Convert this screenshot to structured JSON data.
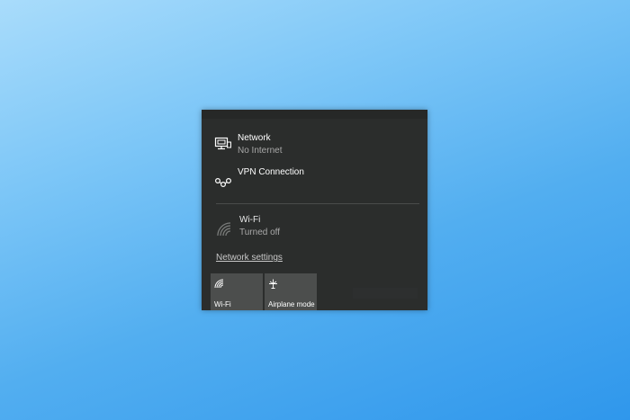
{
  "networks": [
    {
      "icon": "wired-network-icon",
      "title": "Network",
      "status": "No Internet"
    },
    {
      "icon": "vpn-icon",
      "title": "VPN Connection",
      "status": ""
    }
  ],
  "wifi": {
    "icon": "wifi-off-icon",
    "title": "Wi-Fi",
    "status": "Turned off"
  },
  "settings_link": "Network settings",
  "quick_actions": [
    {
      "icon": "wifi-icon",
      "label": "Wi-Fi"
    },
    {
      "icon": "airplane-icon",
      "label": "Airplane mode"
    }
  ],
  "colors": {
    "flyout_bg": "#2b2d2c",
    "tile_bg": "#4c4e4d",
    "text_primary": "#ffffff",
    "text_secondary": "#a8a8a8"
  }
}
